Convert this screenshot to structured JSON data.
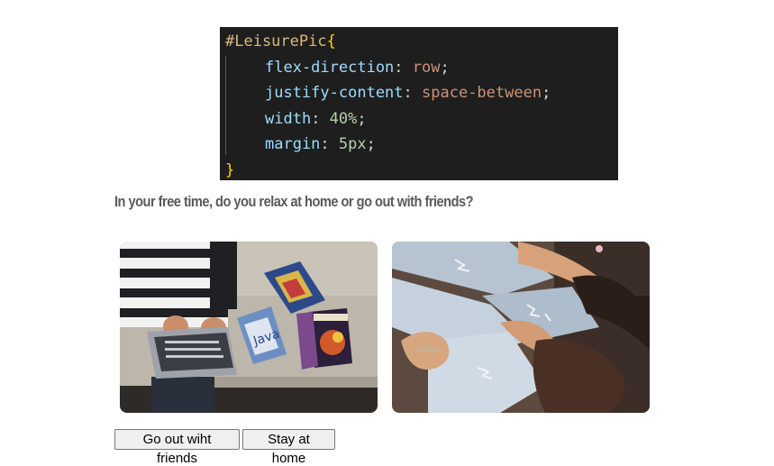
{
  "code": {
    "selector": "#LeisurePic",
    "open_brace": "{",
    "close_brace": "}",
    "lines": [
      {
        "prop": "flex-direction",
        "value": "row",
        "value_type": "keyword"
      },
      {
        "prop": "justify-content",
        "value": "space-between",
        "value_type": "keyword"
      },
      {
        "prop": "width",
        "value": "40%",
        "value_type": "number"
      },
      {
        "prop": "margin",
        "value": "5px",
        "value_type": "number"
      }
    ]
  },
  "question": "In your free time, do you relax at home or go out with friends?",
  "images": {
    "home": {
      "alt": "Person using a laptop on a couch with books"
    },
    "friends": {
      "alt": "Friends sitting together in ripped jeans"
    }
  },
  "buttons": {
    "go_out": "Go out wiht friends",
    "stay_home": "Stay at home"
  },
  "colors": {
    "code_bg": "#1e1e1e",
    "selector": "#d7ba7d",
    "brace": "#ffd700",
    "property": "#9cdcfe",
    "keyword_value": "#ce9178",
    "number_value": "#b5cea8",
    "question_text": "#5a5a5a"
  }
}
